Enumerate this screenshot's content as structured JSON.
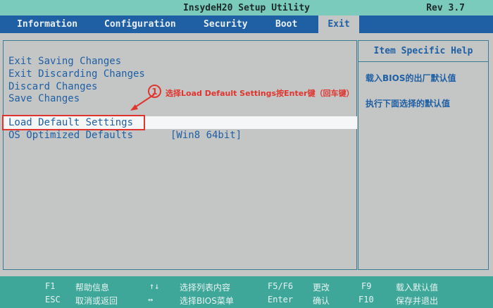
{
  "title": "InsydeH20 Setup Utility",
  "revision": "Rev 3.7",
  "tabs": [
    {
      "label": "Information"
    },
    {
      "label": "Configuration"
    },
    {
      "label": "Security"
    },
    {
      "label": "Boot"
    },
    {
      "label": "Exit",
      "active": true
    }
  ],
  "exit_menu": {
    "items": [
      {
        "label": "Exit Saving Changes"
      },
      {
        "label": "Exit Discarding Changes"
      },
      {
        "label": "Discard Changes"
      },
      {
        "label": "Save Changes"
      },
      {
        "label": "Load Default Settings",
        "selected": true
      },
      {
        "label": "OS Optimized Defaults",
        "value": "[Win8 64bit]"
      }
    ]
  },
  "help_panel": {
    "title": "Item Specific Help",
    "lines": [
      "载入BIOS的出厂默认值",
      "执行下面选择的默认值"
    ]
  },
  "annotation": {
    "number": "1",
    "text": "选择Load Default Settings按Enter键（回车键）",
    "color": "#e0352f"
  },
  "footer": {
    "row1": [
      {
        "key": "F1",
        "desc": "帮助信息"
      },
      {
        "key": "↑↓",
        "desc": "选择列表内容"
      },
      {
        "key": "F5/F6",
        "desc": "更改"
      },
      {
        "key": "F9",
        "desc": "载入默认值"
      }
    ],
    "row2": [
      {
        "key": "ESC",
        "desc": "取消或返回"
      },
      {
        "key": "↔",
        "desc": "选择BIOS菜单"
      },
      {
        "key": "Enter",
        "desc": "确认"
      },
      {
        "key": "F10",
        "desc": "保存并退出"
      }
    ]
  },
  "colors": {
    "background": "#c4c6c6",
    "title_bar": "#7bcbbd",
    "menu_bar": "#1f5fa3",
    "text_blue": "#1f5fa3",
    "footer": "#3fa69a",
    "highlight": "#f4f6f8"
  }
}
